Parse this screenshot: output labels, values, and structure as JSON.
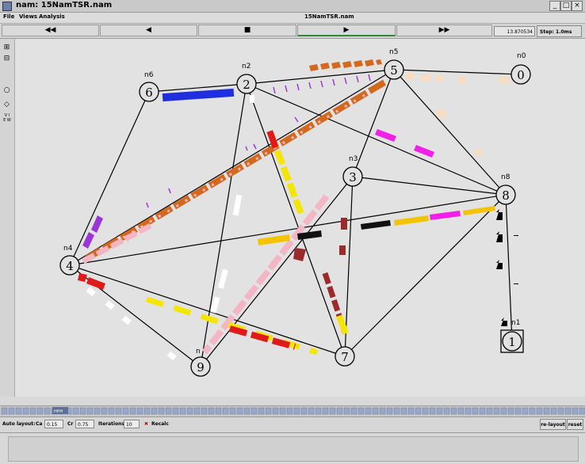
{
  "window": {
    "title": "nam: 15NamTSR.nam"
  },
  "menu": {
    "items": [
      "File",
      "Views",
      "Analysis"
    ],
    "file_title": "15NamTSR.nam"
  },
  "toolbar": {
    "rewind": "◀◀",
    "back": "◀",
    "stop": "■",
    "play": "▶",
    "fastforward": "▶▶",
    "time": "13.870534",
    "step": "Step: 1.0ms"
  },
  "sidebar": {
    "view_label": "V I E W"
  },
  "network": {
    "node_labels": {
      "n0": "n0",
      "n2": "n2",
      "n3": "n3",
      "n4": "n4",
      "n5": "n5",
      "n6": "n6",
      "n8": "n8",
      "n1": "n1",
      "n9": "n"
    },
    "node_ids": {
      "n0": "0",
      "n1": "1",
      "n2": "2",
      "n3": "3",
      "n4": "4",
      "n5": "5",
      "n6": "6",
      "n7": "7",
      "n8": "8",
      "n9": "9"
    }
  },
  "timeline": {
    "marker": "HHH"
  },
  "bottom": {
    "auto_layout_label": "Auto layout:",
    "ca_label": "Ca",
    "ca_value": "0.15",
    "cr_label": "Cr",
    "cr_value": "0.75",
    "iterations_label": "Iterations",
    "iterations_value": "10",
    "recalc_label": "Recalc",
    "relayout_label": "re-layout",
    "reset_label": "reset"
  },
  "colors": {
    "orange": "#d2691e",
    "blue": "#1f2fe0",
    "yellow": "#f5e600",
    "pink": "#f4b6c4",
    "magenta": "#f020e8",
    "red": "#e01a1a",
    "darkred": "#9b2a2a",
    "purple": "#9a36d8",
    "peach": "#f8dcc0",
    "black": "#111111"
  }
}
